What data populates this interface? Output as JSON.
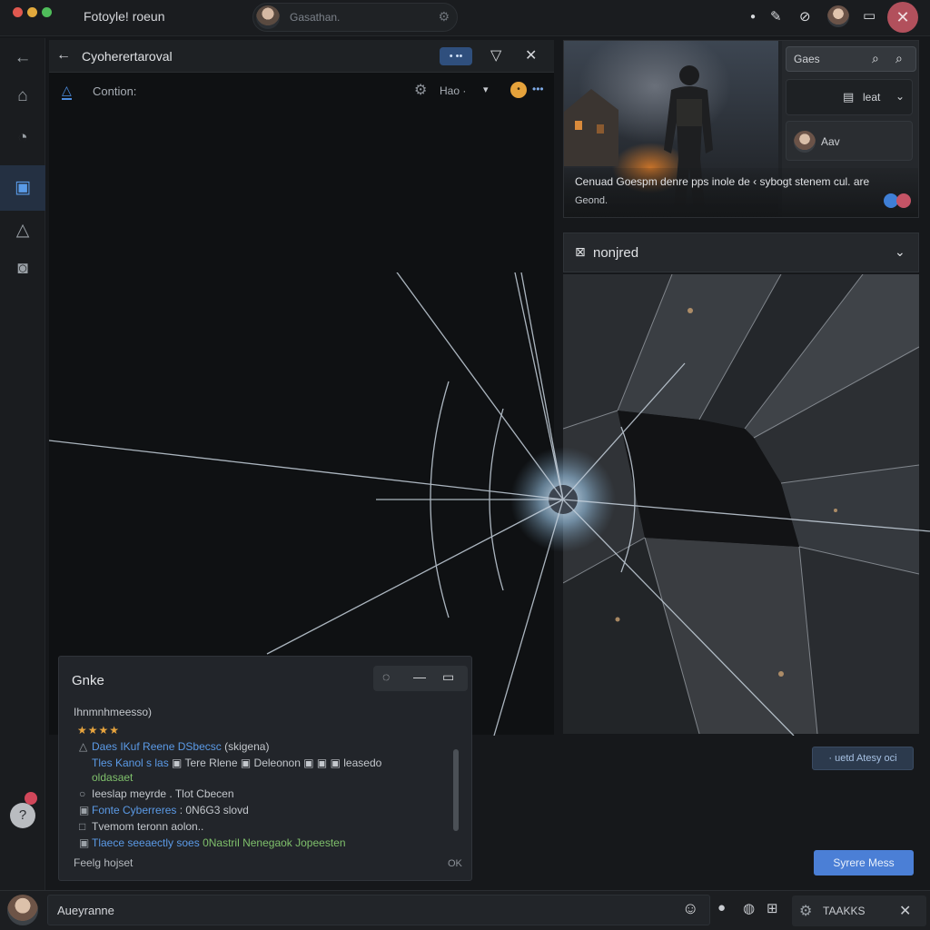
{
  "titlebar": {
    "title": "Fotoyle! roeun",
    "search_placeholder": "Gasathan.",
    "icons": [
      "settings-icon",
      "tool-icon",
      "block-icon",
      "minimize-icon",
      "close-icon"
    ]
  },
  "rail": {
    "items": [
      "back-icon",
      "home-icon",
      "history-icon",
      "media-icon",
      "alert-icon",
      "camera-icon"
    ],
    "active": "media-icon"
  },
  "main": {
    "title": "Cyoherertaroval",
    "pill": "• ••",
    "sub_label": "Contion:",
    "mode_label": "Hao ·",
    "badge": "•"
  },
  "hero": {
    "search_label": "Gaes",
    "select_label": "leat",
    "user_name": "Aav",
    "caption_line1": "Cenuad Goespm denre pps inole de ‹ sybogt stenem cul. are",
    "caption_line2": "Geond."
  },
  "section": {
    "title": "nonjred"
  },
  "chat": {
    "title": "Gnke",
    "heading": "Ihnmnhmeesso)",
    "stars": "★★★★",
    "lines": [
      {
        "bullet": "△",
        "hl": "Daes IKuf Reene DSbecsc",
        "text": " (skigena)"
      },
      {
        "bullet": "",
        "hl": "Tles Kanol s las",
        "text": " ▣ Tere Rlene ▣ Deleonon ▣ ▣ ▣ leasedo"
      },
      {
        "bullet": "",
        "hl": "",
        "text": "oldasaet",
        "green": true
      },
      {
        "bullet": "○",
        "hl": "",
        "text": "Ieeslap meyrde . Tlot Cbecen"
      },
      {
        "bullet": "▣",
        "hl": "Fonte Cyberreres",
        "text": " : 0N6G3 slovd"
      },
      {
        "bullet": "□",
        "hl": "",
        "text": "Tvemom teronn aolon.."
      },
      {
        "bullet": "▣",
        "hl": "Tlaece seeaectly soes",
        "text": " 0Nastril Nenegaok Jopeesten",
        "green_text": true
      }
    ],
    "footer": "Feelg hojset",
    "ok": "OK"
  },
  "buttons": {
    "link": "· uetd Atesy oci",
    "primary": "Syrere Mess"
  },
  "bottombar": {
    "input_value": "Aueyranne",
    "tasks_label": "TAAKKS"
  },
  "colors": {
    "accent": "#4b7fd6",
    "danger": "#b2505c",
    "star": "#e7a43e"
  }
}
